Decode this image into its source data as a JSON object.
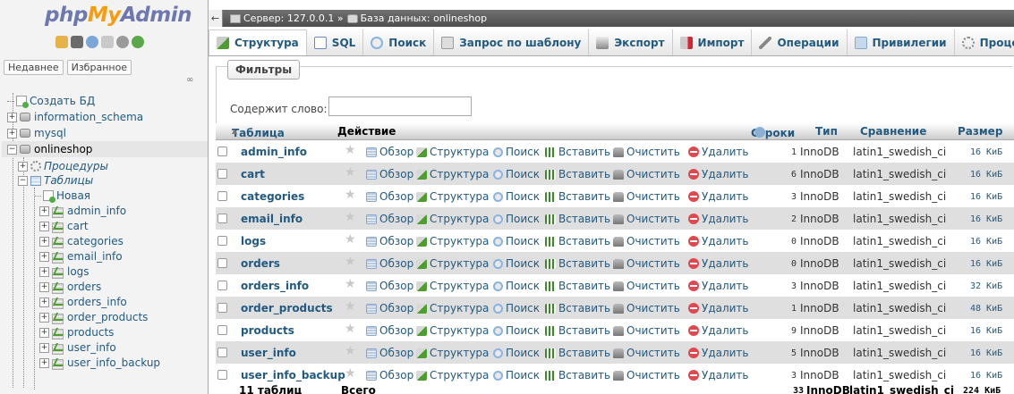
{
  "logo": {
    "php": "php",
    "my": "My",
    "admin": "Admin"
  },
  "nav_tabs": [
    "Недавнее",
    "Избранное"
  ],
  "tree": {
    "create_db": "Создать БД",
    "databases": [
      "information_schema",
      "mysql",
      "onlineshop"
    ],
    "procedures": "Процедуры",
    "tables_group": "Таблицы",
    "new": "Новая",
    "tables": [
      "admin_info",
      "cart",
      "categories",
      "email_info",
      "logs",
      "orders",
      "orders_info",
      "order_products",
      "products",
      "user_info",
      "user_info_backup"
    ]
  },
  "breadcrumb": {
    "server": "Сервер: 127.0.0.1 »",
    "database": "База данных: onlineshop"
  },
  "menu": [
    "Структура",
    "SQL",
    "Поиск",
    "Запрос по шаблону",
    "Экспорт",
    "Импорт",
    "Операции",
    "Привилегии",
    "Проце"
  ],
  "filters": {
    "legend": "Фильтры",
    "label": "Содержит слово:",
    "value": ""
  },
  "columns": {
    "table": "Таблица",
    "sort": "▲",
    "action": "Действие",
    "rows": "Строки",
    "type": "Тип",
    "collation": "Сравнение",
    "size": "Размер"
  },
  "actions": {
    "browse": "Обзор",
    "structure": "Структура",
    "search": "Поиск",
    "insert": "Вставить",
    "empty": "Очистить",
    "drop": "Удалить"
  },
  "rows": [
    {
      "name": "admin_info",
      "rows": "1",
      "type": "InnoDB",
      "collation": "latin1_swedish_ci",
      "size": "16 КиБ"
    },
    {
      "name": "cart",
      "rows": "6",
      "type": "InnoDB",
      "collation": "latin1_swedish_ci",
      "size": "16 КиБ"
    },
    {
      "name": "categories",
      "rows": "3",
      "type": "InnoDB",
      "collation": "latin1_swedish_ci",
      "size": "16 КиБ"
    },
    {
      "name": "email_info",
      "rows": "2",
      "type": "InnoDB",
      "collation": "latin1_swedish_ci",
      "size": "16 КиБ"
    },
    {
      "name": "logs",
      "rows": "0",
      "type": "InnoDB",
      "collation": "latin1_swedish_ci",
      "size": "16 КиБ"
    },
    {
      "name": "orders",
      "rows": "0",
      "type": "InnoDB",
      "collation": "latin1_swedish_ci",
      "size": "16 КиБ"
    },
    {
      "name": "orders_info",
      "rows": "3",
      "type": "InnoDB",
      "collation": "latin1_swedish_ci",
      "size": "32 КиБ"
    },
    {
      "name": "order_products",
      "rows": "1",
      "type": "InnoDB",
      "collation": "latin1_swedish_ci",
      "size": "48 КиБ"
    },
    {
      "name": "products",
      "rows": "9",
      "type": "InnoDB",
      "collation": "latin1_swedish_ci",
      "size": "16 КиБ"
    },
    {
      "name": "user_info",
      "rows": "5",
      "type": "InnoDB",
      "collation": "latin1_swedish_ci",
      "size": "16 КиБ"
    },
    {
      "name": "user_info_backup",
      "rows": "3",
      "type": "InnoDB",
      "collation": "latin1_swedish_ci",
      "size": "16 КиБ"
    }
  ],
  "footer": {
    "count": "11 таблиц",
    "total": "Всего",
    "rows": "33",
    "type": "InnoDB",
    "collation": "latin1_swedish_ci",
    "size": "224 КиБ"
  },
  "colors": {
    "link": "#235a81",
    "row_alt": "#dfdfdf",
    "topbar": "#5a5a5a",
    "logo_blue": "#6c78af",
    "logo_orange": "#f89c0e"
  }
}
